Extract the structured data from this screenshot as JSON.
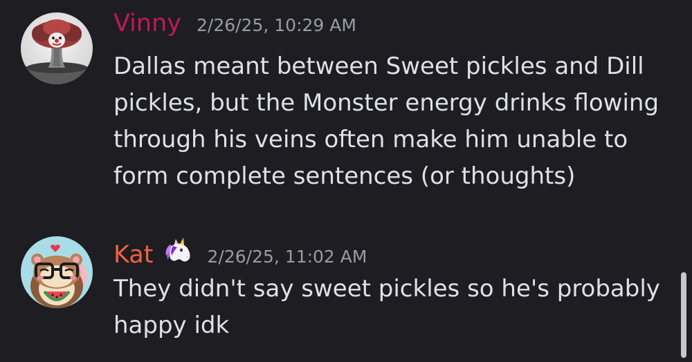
{
  "colors": {
    "background": "#1d1d22",
    "message_text": "#e0e1e6",
    "timestamp": "#9a9ba5",
    "scrollbar": "#c7c8cc"
  },
  "messages": [
    {
      "username": "Vinny",
      "username_color": "#c2185b",
      "timestamp": "2/26/25, 10:29 AM",
      "avatar_icon": "mushroom-cloud-clown-avatar",
      "text": "Dallas meant between Sweet pickles and Dill\npickles, but the Monster energy drinks flowing\nthrough his veins often make him unable to\nform complete sentences (or thoughts)"
    },
    {
      "username": "Kat",
      "username_color": "#f0623e",
      "badge_icon": "unicorn-icon",
      "timestamp": "2/26/25, 11:02 AM",
      "avatar_icon": "hamster-with-glasses-avatar",
      "text": "They didn't say sweet pickles so he's probably\nhappy idk"
    }
  ]
}
